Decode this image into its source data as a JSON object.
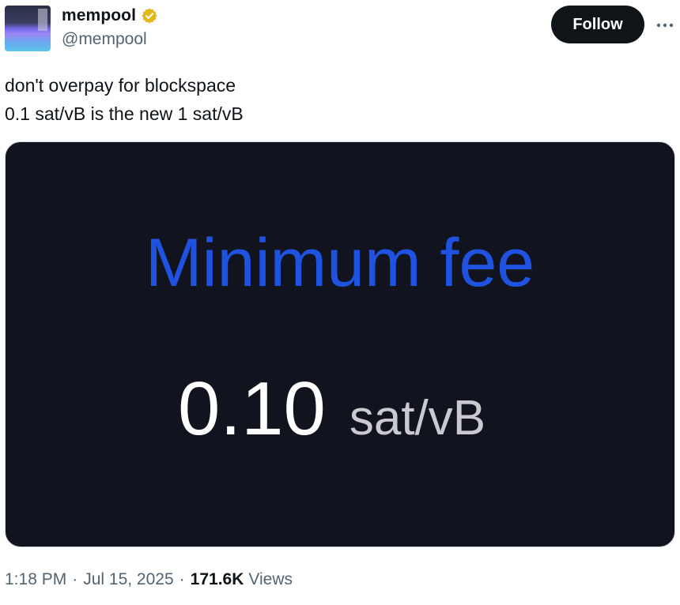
{
  "author": {
    "display_name": "mempool",
    "handle": "@mempool",
    "verified_badge_color": "#e2b719"
  },
  "actions": {
    "follow_label": "Follow",
    "more_icon": "more-horizontal-icon"
  },
  "tweet": {
    "lines": [
      "don't overpay for blockspace",
      "0.1 sat/vB is the new 1 sat/vB"
    ]
  },
  "media": {
    "title": "Minimum fee",
    "value": "0.10",
    "unit": "sat/vB",
    "title_color": "#1f52e0",
    "background": "#11131e"
  },
  "meta": {
    "time": "1:18 PM",
    "date": "Jul 15, 2025",
    "views_count": "171.6K",
    "views_label": "Views"
  }
}
